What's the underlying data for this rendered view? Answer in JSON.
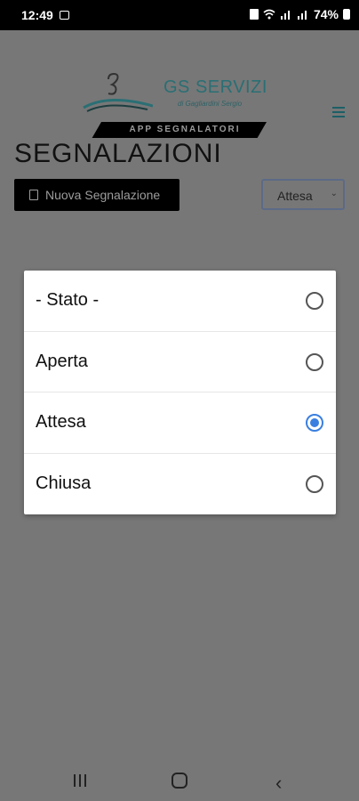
{
  "status_bar": {
    "time": "12:49",
    "battery": "74%"
  },
  "header": {
    "brand": "GS SERVIZI",
    "brand_sub": "di Gagliardini Sergio",
    "banner": "APP SEGNALATORI"
  },
  "page": {
    "title": "SEGNALAZIONI",
    "new_button_label": "Nuova Segnalazione",
    "filter_value": "Attesa"
  },
  "dialog": {
    "options": [
      {
        "label": "- Stato -",
        "selected": false
      },
      {
        "label": "Aperta",
        "selected": false
      },
      {
        "label": "Attesa",
        "selected": true
      },
      {
        "label": "Chiusa",
        "selected": false
      }
    ]
  },
  "colors": {
    "accent": "#3a7fe0",
    "scrim": "#777777",
    "brand": "#2a6f74"
  }
}
